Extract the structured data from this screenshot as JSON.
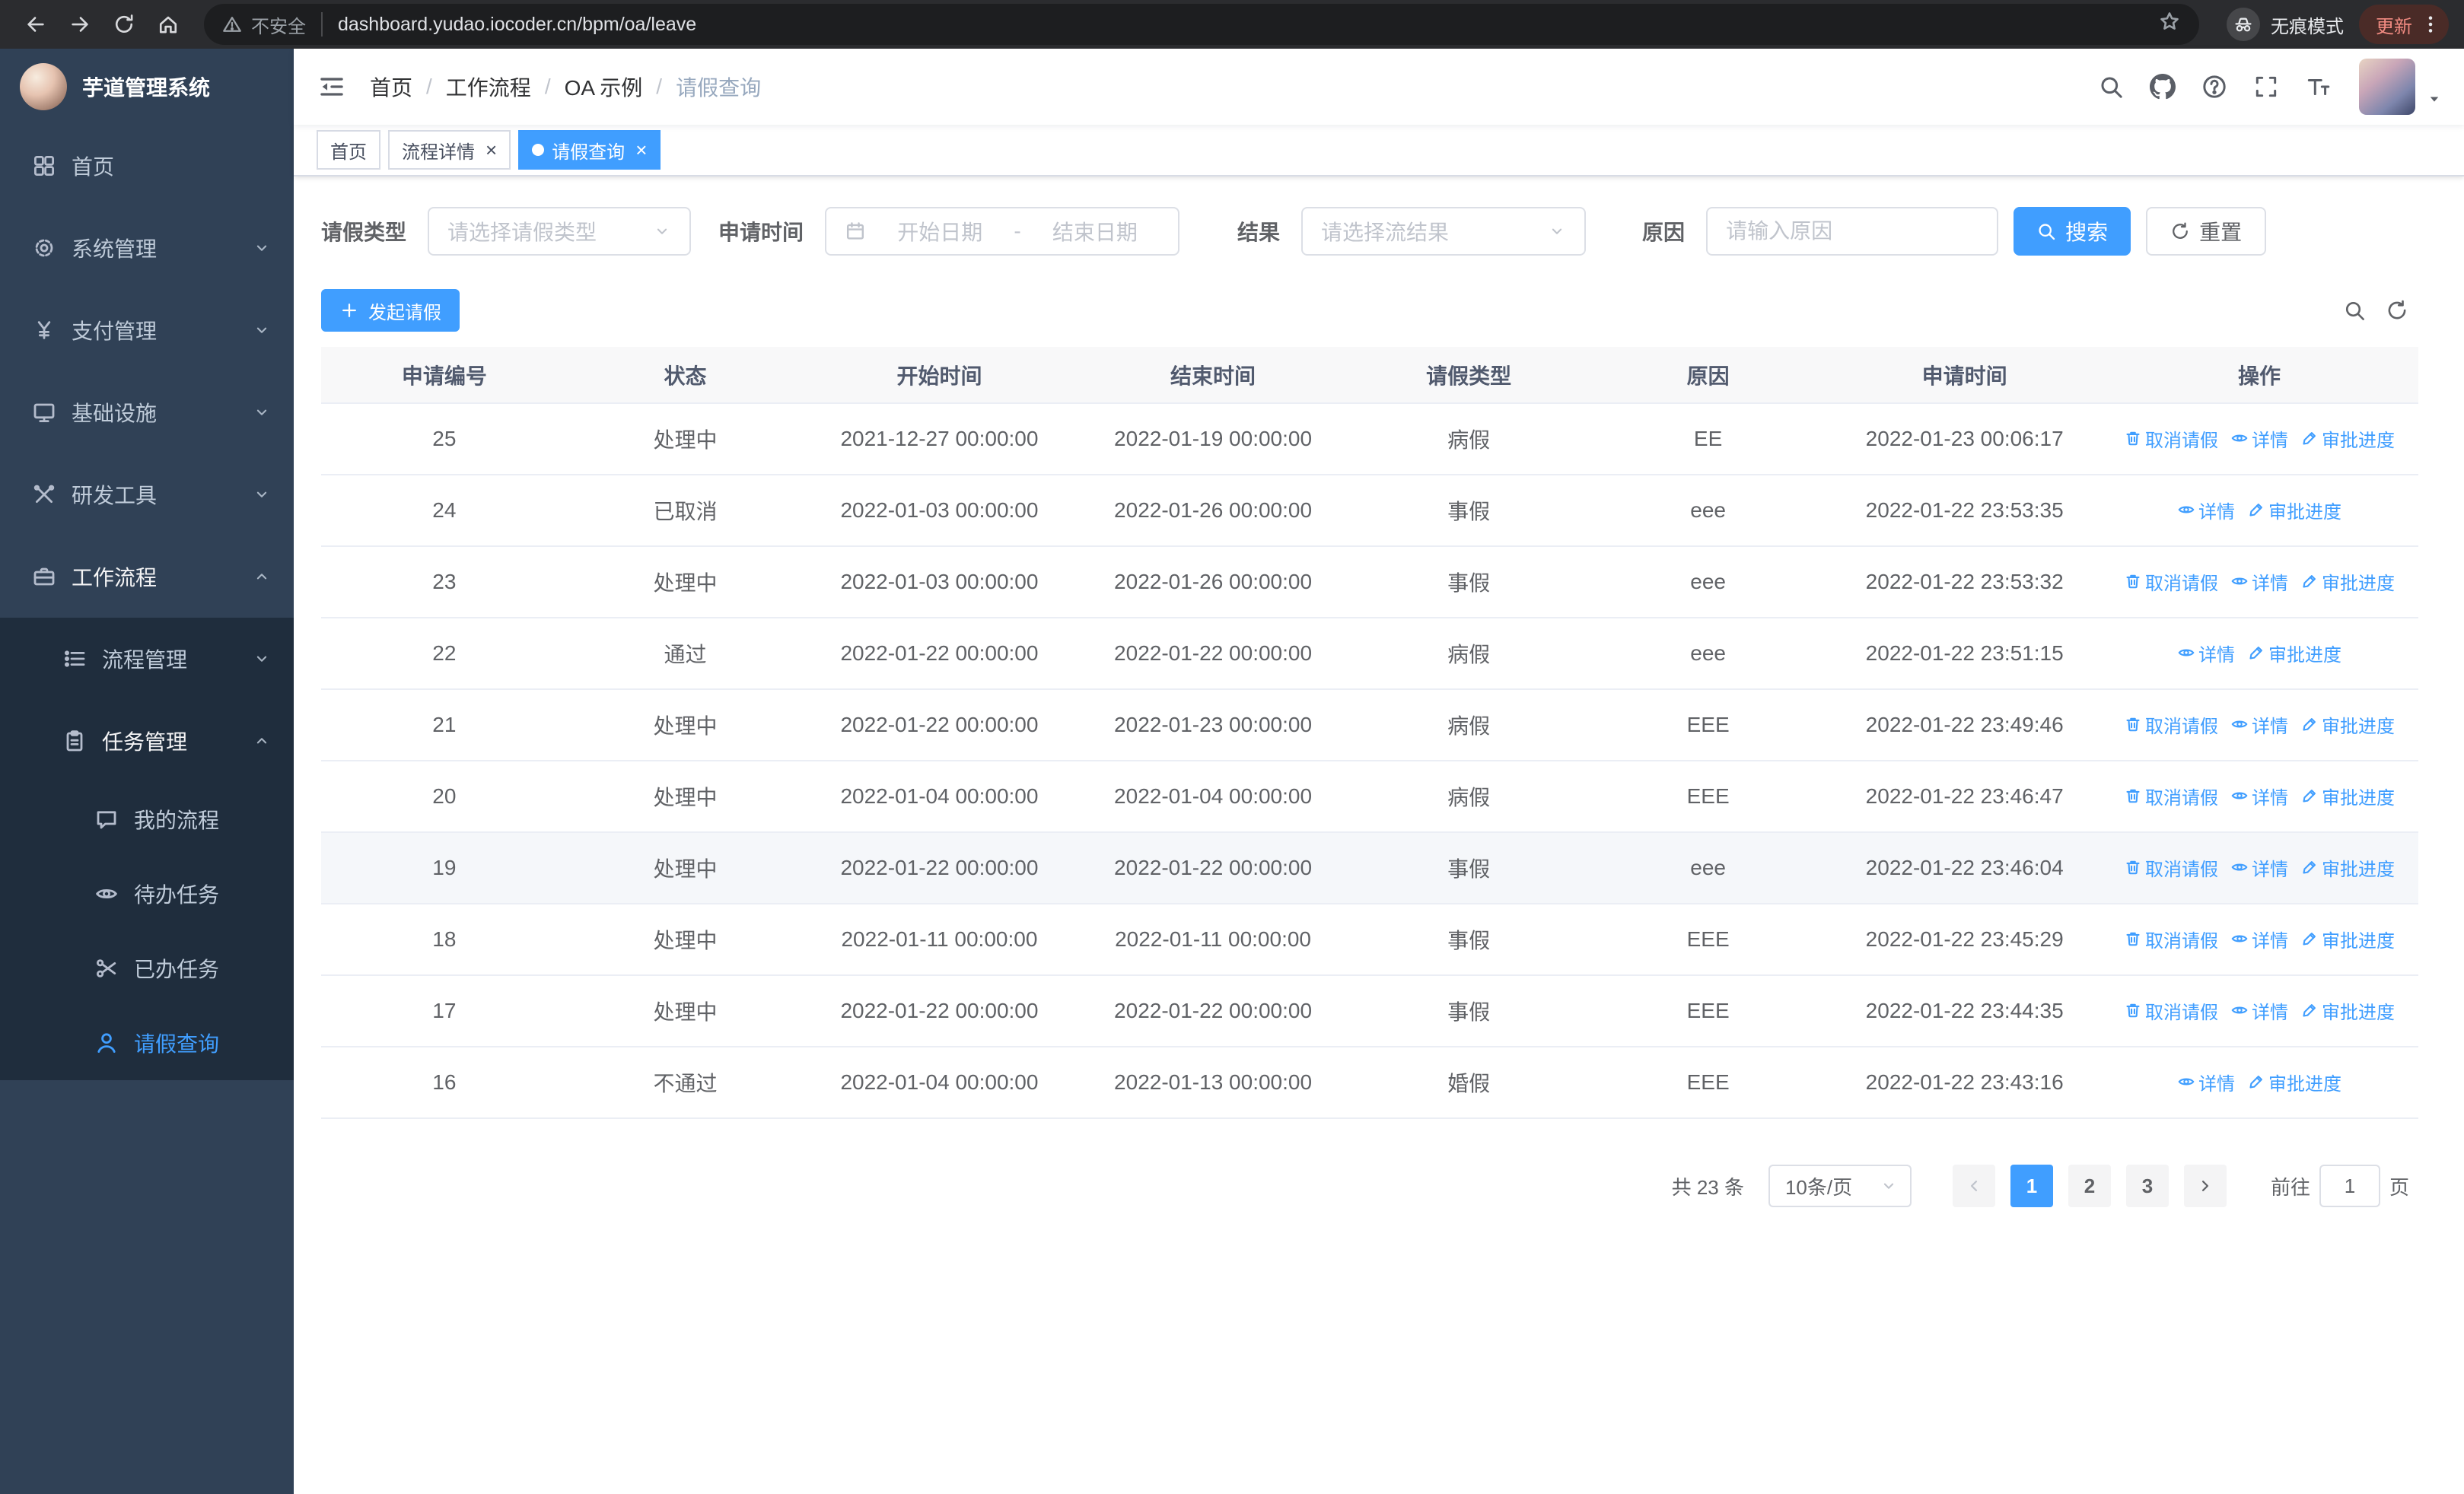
{
  "browser": {
    "security_label": "不安全",
    "url": "dashboard.yudao.iocoder.cn/bpm/oa/leave",
    "incognito_label": "无痕模式",
    "update_label": "更新"
  },
  "sidebar": {
    "logo_title": "芋道管理系统",
    "menu": [
      {
        "name": "sidebar-item-home",
        "label": "首页",
        "icon": "dashboard-icon",
        "level": 1
      },
      {
        "name": "sidebar-item-system-mgmt",
        "label": "系统管理",
        "icon": "gear-icon",
        "level": 1,
        "chevron": "down"
      },
      {
        "name": "sidebar-item-payment-mgmt",
        "label": "支付管理",
        "icon": "yen-icon",
        "level": 1,
        "chevron": "down"
      },
      {
        "name": "sidebar-item-infrastructure",
        "label": "基础设施",
        "icon": "monitor-icon",
        "level": 1,
        "chevron": "down"
      },
      {
        "name": "sidebar-item-dev-tools",
        "label": "研发工具",
        "icon": "toolbox-icon",
        "level": 1,
        "chevron": "down"
      },
      {
        "name": "sidebar-item-workflow",
        "label": "工作流程",
        "icon": "briefcase-icon",
        "level": 1,
        "chevron": "up",
        "open": true
      },
      {
        "name": "sidebar-item-process-mgmt",
        "label": "流程管理",
        "icon": "list-icon",
        "level": 2,
        "chevron": "down"
      },
      {
        "name": "sidebar-item-task-mgmt",
        "label": "任务管理",
        "icon": "clipboard-icon",
        "level": 2,
        "chevron": "up",
        "open": true
      },
      {
        "name": "sidebar-item-my-process",
        "label": "我的流程",
        "icon": "chat-icon",
        "level": 3
      },
      {
        "name": "sidebar-item-todo-tasks",
        "label": "待办任务",
        "icon": "eye-icon",
        "level": 3
      },
      {
        "name": "sidebar-item-done-tasks",
        "label": "已办任务",
        "icon": "scissors-icon",
        "level": 3
      },
      {
        "name": "sidebar-item-leave-query",
        "label": "请假查询",
        "icon": "user-icon",
        "level": 3,
        "active": true
      }
    ]
  },
  "header": {
    "breadcrumb": [
      "首页",
      "工作流程",
      "OA 示例",
      "请假查询"
    ]
  },
  "tabs": [
    {
      "name": "tab-home",
      "label": "首页",
      "closable": false,
      "active": false
    },
    {
      "name": "tab-process-detail",
      "label": "流程详情",
      "closable": true,
      "active": false
    },
    {
      "name": "tab-leave-query",
      "label": "请假查询",
      "closable": true,
      "active": true
    }
  ],
  "filters": {
    "leave_type": {
      "label": "请假类型",
      "placeholder": "请选择请假类型"
    },
    "apply_time": {
      "label": "申请时间",
      "start_placeholder": "开始日期",
      "separator": "-",
      "end_placeholder": "结束日期"
    },
    "result": {
      "label": "结果",
      "placeholder": "请选择流结果"
    },
    "reason": {
      "label": "原因",
      "placeholder": "请输入原因"
    },
    "search_button": "搜索",
    "reset_button": "重置"
  },
  "toolbar": {
    "create_button": "发起请假"
  },
  "table": {
    "headers": [
      "申请编号",
      "状态",
      "开始时间",
      "结束时间",
      "请假类型",
      "原因",
      "申请时间",
      "操作"
    ],
    "action_labels": {
      "cancel": "取消请假",
      "detail": "详情",
      "progress": "审批进度"
    },
    "rows": [
      {
        "id": "25",
        "status": "处理中",
        "start": "2021-12-27 00:00:00",
        "end": "2022-01-19 00:00:00",
        "type": "病假",
        "reason": "EE",
        "applied": "2022-01-23 00:06:17",
        "actions": [
          "cancel",
          "detail",
          "progress"
        ]
      },
      {
        "id": "24",
        "status": "已取消",
        "start": "2022-01-03 00:00:00",
        "end": "2022-01-26 00:00:00",
        "type": "事假",
        "reason": "eee",
        "applied": "2022-01-22 23:53:35",
        "actions": [
          "detail",
          "progress"
        ]
      },
      {
        "id": "23",
        "status": "处理中",
        "start": "2022-01-03 00:00:00",
        "end": "2022-01-26 00:00:00",
        "type": "事假",
        "reason": "eee",
        "applied": "2022-01-22 23:53:32",
        "actions": [
          "cancel",
          "detail",
          "progress"
        ]
      },
      {
        "id": "22",
        "status": "通过",
        "start": "2022-01-22 00:00:00",
        "end": "2022-01-22 00:00:00",
        "type": "病假",
        "reason": "eee",
        "applied": "2022-01-22 23:51:15",
        "actions": [
          "detail",
          "progress"
        ]
      },
      {
        "id": "21",
        "status": "处理中",
        "start": "2022-01-22 00:00:00",
        "end": "2022-01-23 00:00:00",
        "type": "病假",
        "reason": "EEE",
        "applied": "2022-01-22 23:49:46",
        "actions": [
          "cancel",
          "detail",
          "progress"
        ]
      },
      {
        "id": "20",
        "status": "处理中",
        "start": "2022-01-04 00:00:00",
        "end": "2022-01-04 00:00:00",
        "type": "病假",
        "reason": "EEE",
        "applied": "2022-01-22 23:46:47",
        "actions": [
          "cancel",
          "detail",
          "progress"
        ]
      },
      {
        "id": "19",
        "status": "处理中",
        "start": "2022-01-22 00:00:00",
        "end": "2022-01-22 00:00:00",
        "type": "事假",
        "reason": "eee",
        "applied": "2022-01-22 23:46:04",
        "actions": [
          "cancel",
          "detail",
          "progress"
        ],
        "hover": true
      },
      {
        "id": "18",
        "status": "处理中",
        "start": "2022-01-11 00:00:00",
        "end": "2022-01-11 00:00:00",
        "type": "事假",
        "reason": "EEE",
        "applied": "2022-01-22 23:45:29",
        "actions": [
          "cancel",
          "detail",
          "progress"
        ]
      },
      {
        "id": "17",
        "status": "处理中",
        "start": "2022-01-22 00:00:00",
        "end": "2022-01-22 00:00:00",
        "type": "事假",
        "reason": "EEE",
        "applied": "2022-01-22 23:44:35",
        "actions": [
          "cancel",
          "detail",
          "progress"
        ]
      },
      {
        "id": "16",
        "status": "不通过",
        "start": "2022-01-04 00:00:00",
        "end": "2022-01-13 00:00:00",
        "type": "婚假",
        "reason": "EEE",
        "applied": "2022-01-22 23:43:16",
        "actions": [
          "detail",
          "progress"
        ]
      }
    ]
  },
  "pagination": {
    "total_label": "共 23 条",
    "page_size": "10条/页",
    "pages": [
      "1",
      "2",
      "3"
    ],
    "current_page": "1",
    "goto_label": "前往",
    "goto_value": "1",
    "goto_unit": "页"
  },
  "colors": {
    "primary": "#409eff",
    "sidebar_bg": "#304156",
    "submenu_bg": "#1f2d3d"
  }
}
